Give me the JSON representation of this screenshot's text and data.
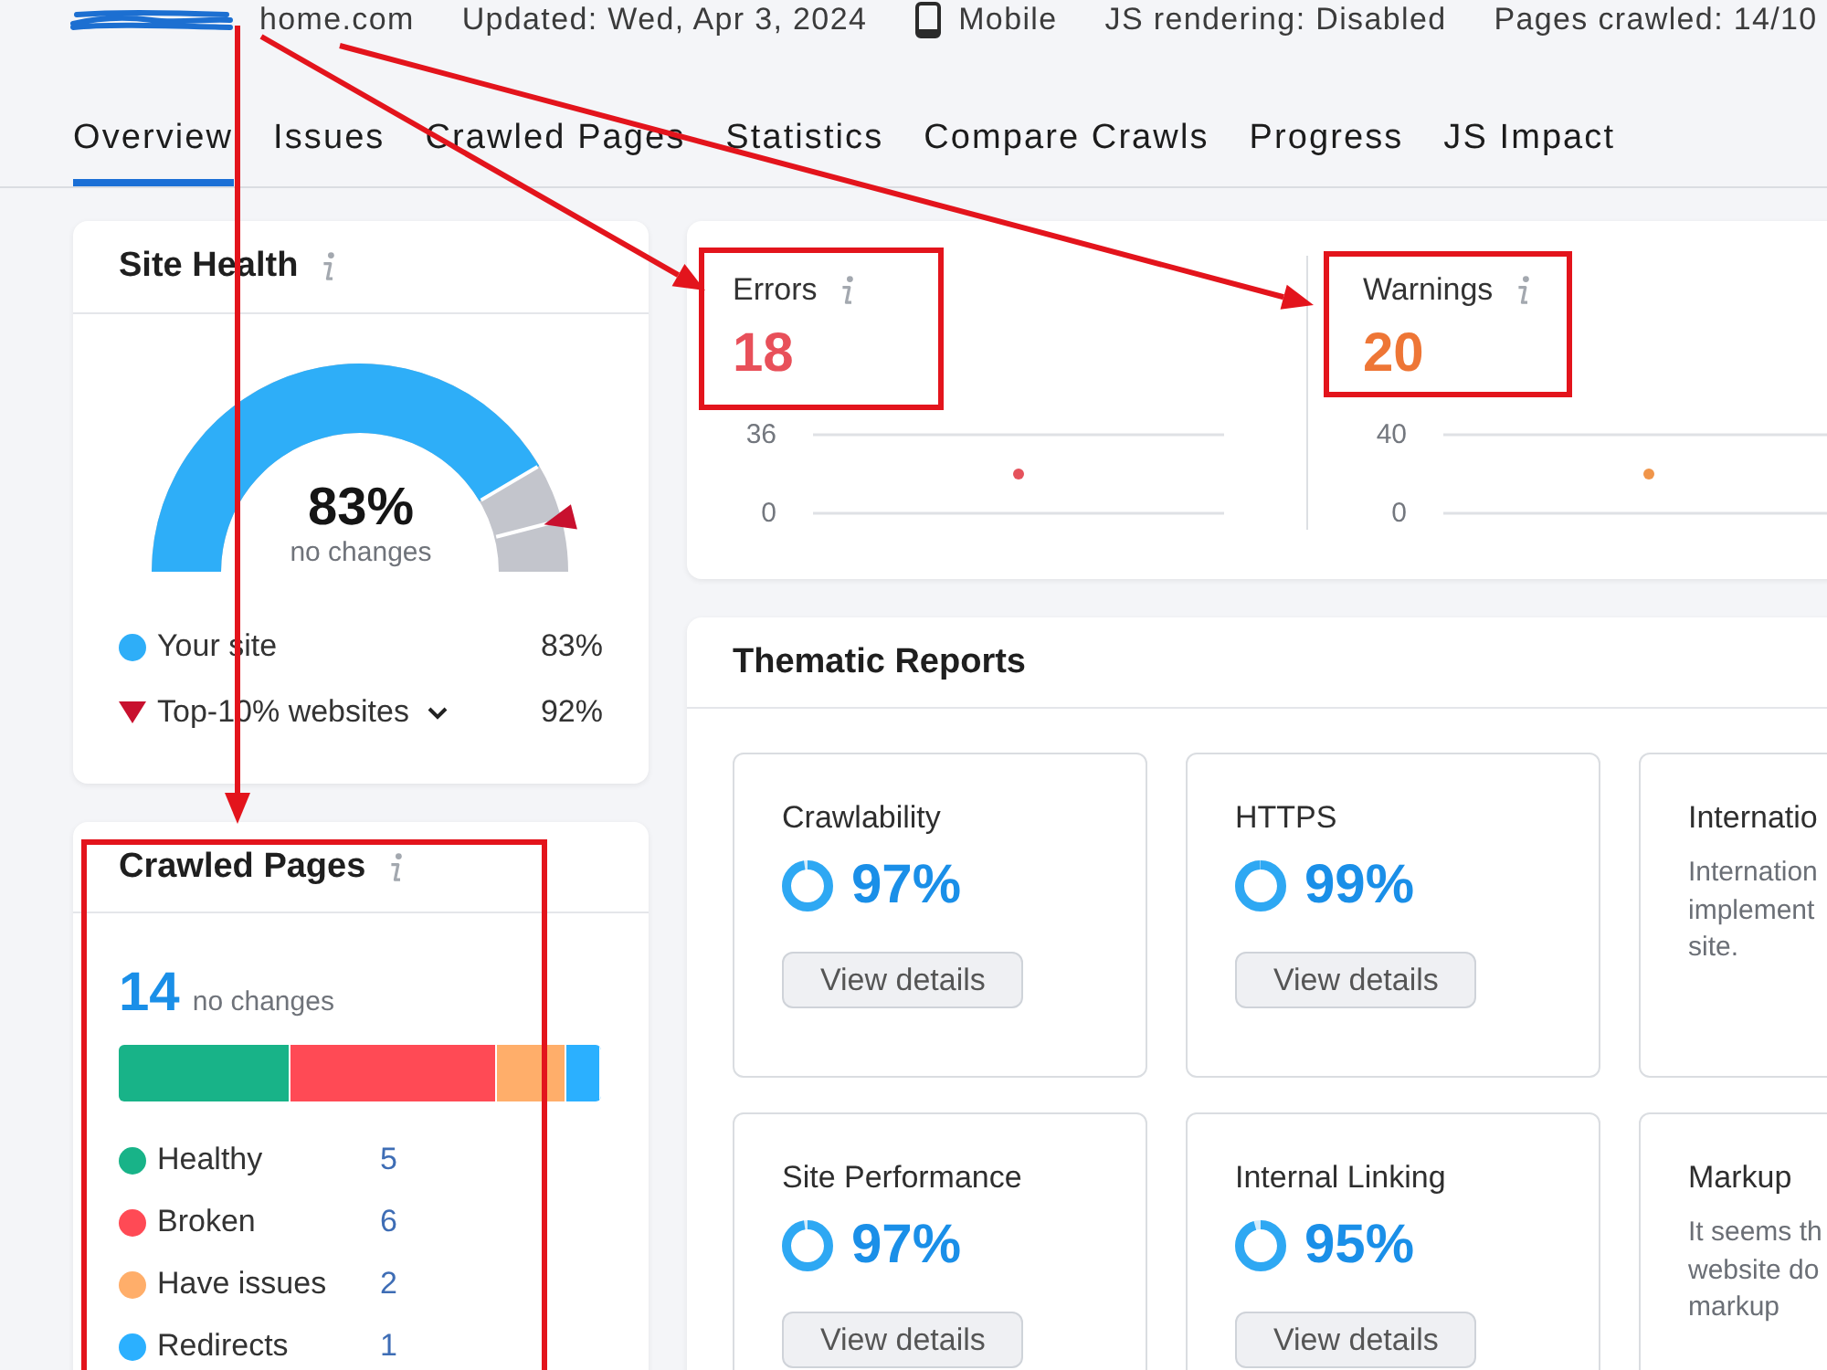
{
  "meta": {
    "domain": "home.com",
    "updated": "Updated: Wed, Apr 3, 2024",
    "device": "Mobile",
    "js_rendering": "JS rendering: Disabled",
    "pages_crawled": "Pages crawled: 14/10"
  },
  "tabs": [
    {
      "label": "Overview",
      "selected": true
    },
    {
      "label": "Issues",
      "selected": false
    },
    {
      "label": "Crawled Pages",
      "selected": false
    },
    {
      "label": "Statistics",
      "selected": false
    },
    {
      "label": "Compare Crawls",
      "selected": false
    },
    {
      "label": "Progress",
      "selected": false
    },
    {
      "label": "JS Impact",
      "selected": false
    }
  ],
  "site_health": {
    "title": "Site Health",
    "value": "83%",
    "note": "no changes",
    "legend": [
      {
        "kind": "site",
        "label": "Your site",
        "value": "83%",
        "color": "#2eaef8"
      },
      {
        "kind": "benchmark",
        "label": "Top-10% websites",
        "value": "92%",
        "color": "#c8102e",
        "dropdown": true
      }
    ]
  },
  "issues": [
    {
      "kind": "errors",
      "label": "Errors",
      "value": "18",
      "chart_data": {
        "type": "scatter",
        "categories": [
          null
        ],
        "ylim": [
          0,
          36
        ],
        "yticks": [
          0,
          36
        ],
        "series": [
          {
            "color": "#e5525c",
            "values": [
              18
            ]
          }
        ]
      }
    },
    {
      "kind": "warnings",
      "label": "Warnings",
      "value": "20",
      "chart_data": {
        "type": "scatter",
        "categories": [
          null
        ],
        "ylim": [
          0,
          40
        ],
        "yticks": [
          0,
          40
        ],
        "series": [
          {
            "color": "#f0954a",
            "values": [
              20
            ]
          }
        ]
      }
    }
  ],
  "crawled_pages": {
    "title": "Crawled Pages",
    "total": "14",
    "note": "no changes",
    "segments": [
      {
        "label": "Healthy",
        "count": "5",
        "color": "#18b388"
      },
      {
        "label": "Broken",
        "count": "6",
        "color": "#ff4a55"
      },
      {
        "label": "Have issues",
        "count": "2",
        "color": "#ffae6a"
      },
      {
        "label": "Redirects",
        "count": "1",
        "color": "#2bb0ff"
      }
    ]
  },
  "thematic_reports": {
    "title": "Thematic Reports",
    "reports": [
      {
        "kind": "score",
        "title": "Crawlability",
        "value": "97%",
        "level": 0.97,
        "button": "View details"
      },
      {
        "kind": "score",
        "title": "HTTPS",
        "value": "99%",
        "level": 0.99,
        "button": "View details"
      },
      {
        "kind": "info",
        "title": "Internatio",
        "description_lines": [
          "Internation",
          "implement",
          "site."
        ]
      },
      {
        "kind": "score",
        "title": "Site Performance",
        "value": "97%",
        "level": 0.97,
        "button": "View details"
      },
      {
        "kind": "score",
        "title": "Internal Linking",
        "value": "95%",
        "level": 0.95,
        "button": "View details"
      },
      {
        "kind": "info",
        "title": "Markup",
        "description_lines": [
          "It seems th",
          "website do",
          "markup"
        ]
      }
    ]
  }
}
